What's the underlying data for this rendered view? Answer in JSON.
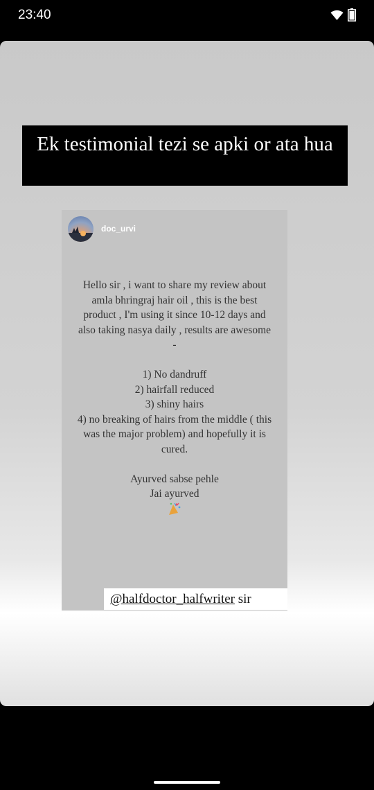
{
  "status_bar": {
    "time": "23:40",
    "icons": [
      "wifi-icon",
      "battery-icon"
    ]
  },
  "story": {
    "headline": "Ek testimonial tezi se apki or ata hua",
    "post": {
      "username": "doc_urvi",
      "paragraph": "Hello sir , i want to share my review about amla bhringraj hair oil , this is the best product , I'm using it since 10-12 days and also taking nasya daily , results are awesome -",
      "list": [
        "1) No dandruff",
        "2) hairfall reduced",
        "3) shiny hairs",
        "4) no breaking of hairs from the middle ( this was the major problem) and hopefully it is cured."
      ],
      "closing_1": "Ayurved sabse pehle",
      "closing_2": "Jai ayurved",
      "emoji": "party-popper-icon"
    },
    "mention": {
      "handle": "@halfdoctor_halfwriter",
      "suffix": "sir"
    }
  }
}
